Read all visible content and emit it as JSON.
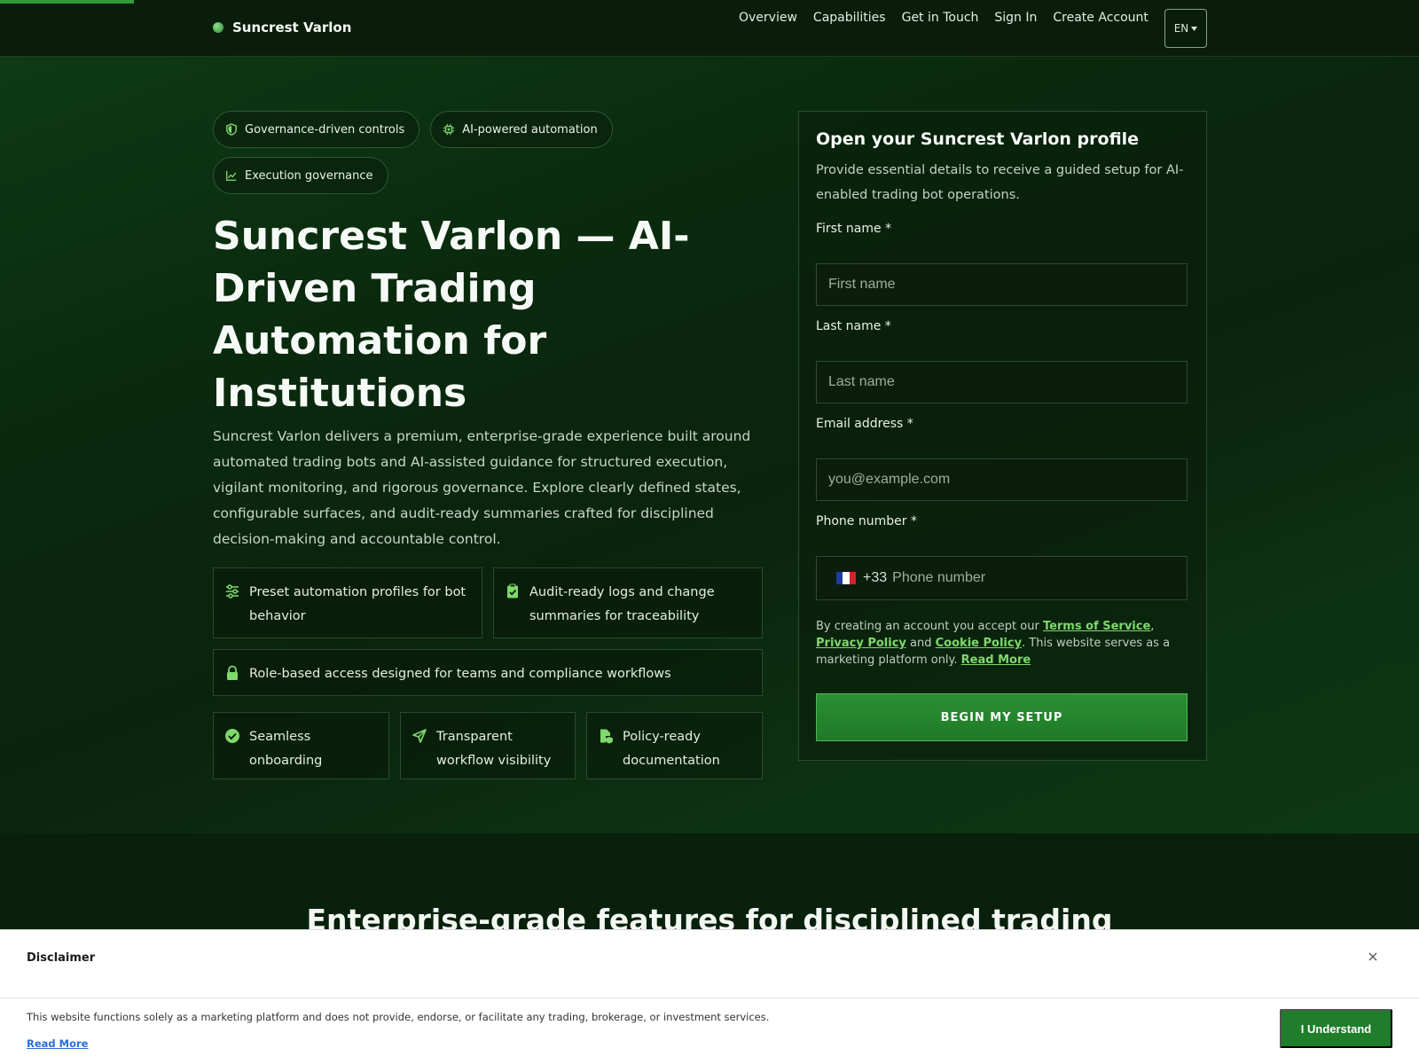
{
  "brand": {
    "name": "Suncrest Varlon"
  },
  "nav": {
    "links": [
      "Overview",
      "Capabilities",
      "Get in Touch",
      "Sign In",
      "Create Account"
    ],
    "language": "EN"
  },
  "hero": {
    "badges": [
      "Governance-driven controls",
      "AI-powered automation",
      "Execution governance"
    ],
    "title": "Suncrest Varlon — AI-Driven Trading Automation for Institutions",
    "description": "Suncrest Varlon delivers a premium, enterprise-grade experience built around automated trading bots and AI-assisted guidance for structured execution, vigilant monitoring, and rigorous governance. Explore clearly defined states, configurable surfaces, and audit-ready summaries crafted for disciplined decision-making and accountable control.",
    "features": [
      "Preset automation profiles for bot behavior",
      "Audit-ready logs and change summaries for traceability",
      "Role-based access designed for teams and compliance workflows",
      "Seamless onboarding",
      "Transparent workflow visibility",
      "Policy-ready documentation"
    ]
  },
  "form": {
    "title": "Open your Suncrest Varlon profile",
    "subtitle": "Provide essential details to receive a guided setup for AI-enabled trading bot operations.",
    "first_name_label": "First name *",
    "first_name_placeholder": "First name",
    "last_name_label": "Last name *",
    "last_name_placeholder": "Last name",
    "email_label": "Email address *",
    "email_placeholder": "you@example.com",
    "phone_label": "Phone number *",
    "phone_code": "+33",
    "phone_placeholder": "Phone number",
    "legal_prefix": "By creating an account you accept our ",
    "terms_link": "Terms of Service",
    "legal_comma": ", ",
    "privacy_link": "Privacy Policy",
    "legal_and": " and ",
    "cookie_link": "Cookie Policy",
    "legal_suffix": ". This website serves as a marketing platform only. ",
    "read_more_link": "Read More",
    "submit_label": "BEGIN MY SETUP"
  },
  "section": {
    "title": "Enterprise-grade features for disciplined trading"
  },
  "disclaimer": {
    "heading": "Disclaimer",
    "close": "×",
    "text": "This website functions solely as a marketing platform and does not provide, endorse, or facilitate any trading, brokerage, or investment services.",
    "read_more": "Read More",
    "button": "I Understand"
  },
  "colors": {
    "accent": "#2f9a3a",
    "link": "#7fd96b",
    "background": "#0a230d",
    "button": "#1f7d2b",
    "flag_blue": "#1f3c9a",
    "flag_white": "#ffffff",
    "flag_red": "#d2232a"
  },
  "icons": {
    "badges": [
      "shield-icon",
      "chip-icon",
      "chart-line-icon"
    ],
    "features": [
      "sliders-icon",
      "clipboard-check-icon",
      "lock-icon",
      "check-circle-icon",
      "send-icon",
      "file-shield-icon"
    ],
    "phone_flag": "france-flag-icon"
  }
}
